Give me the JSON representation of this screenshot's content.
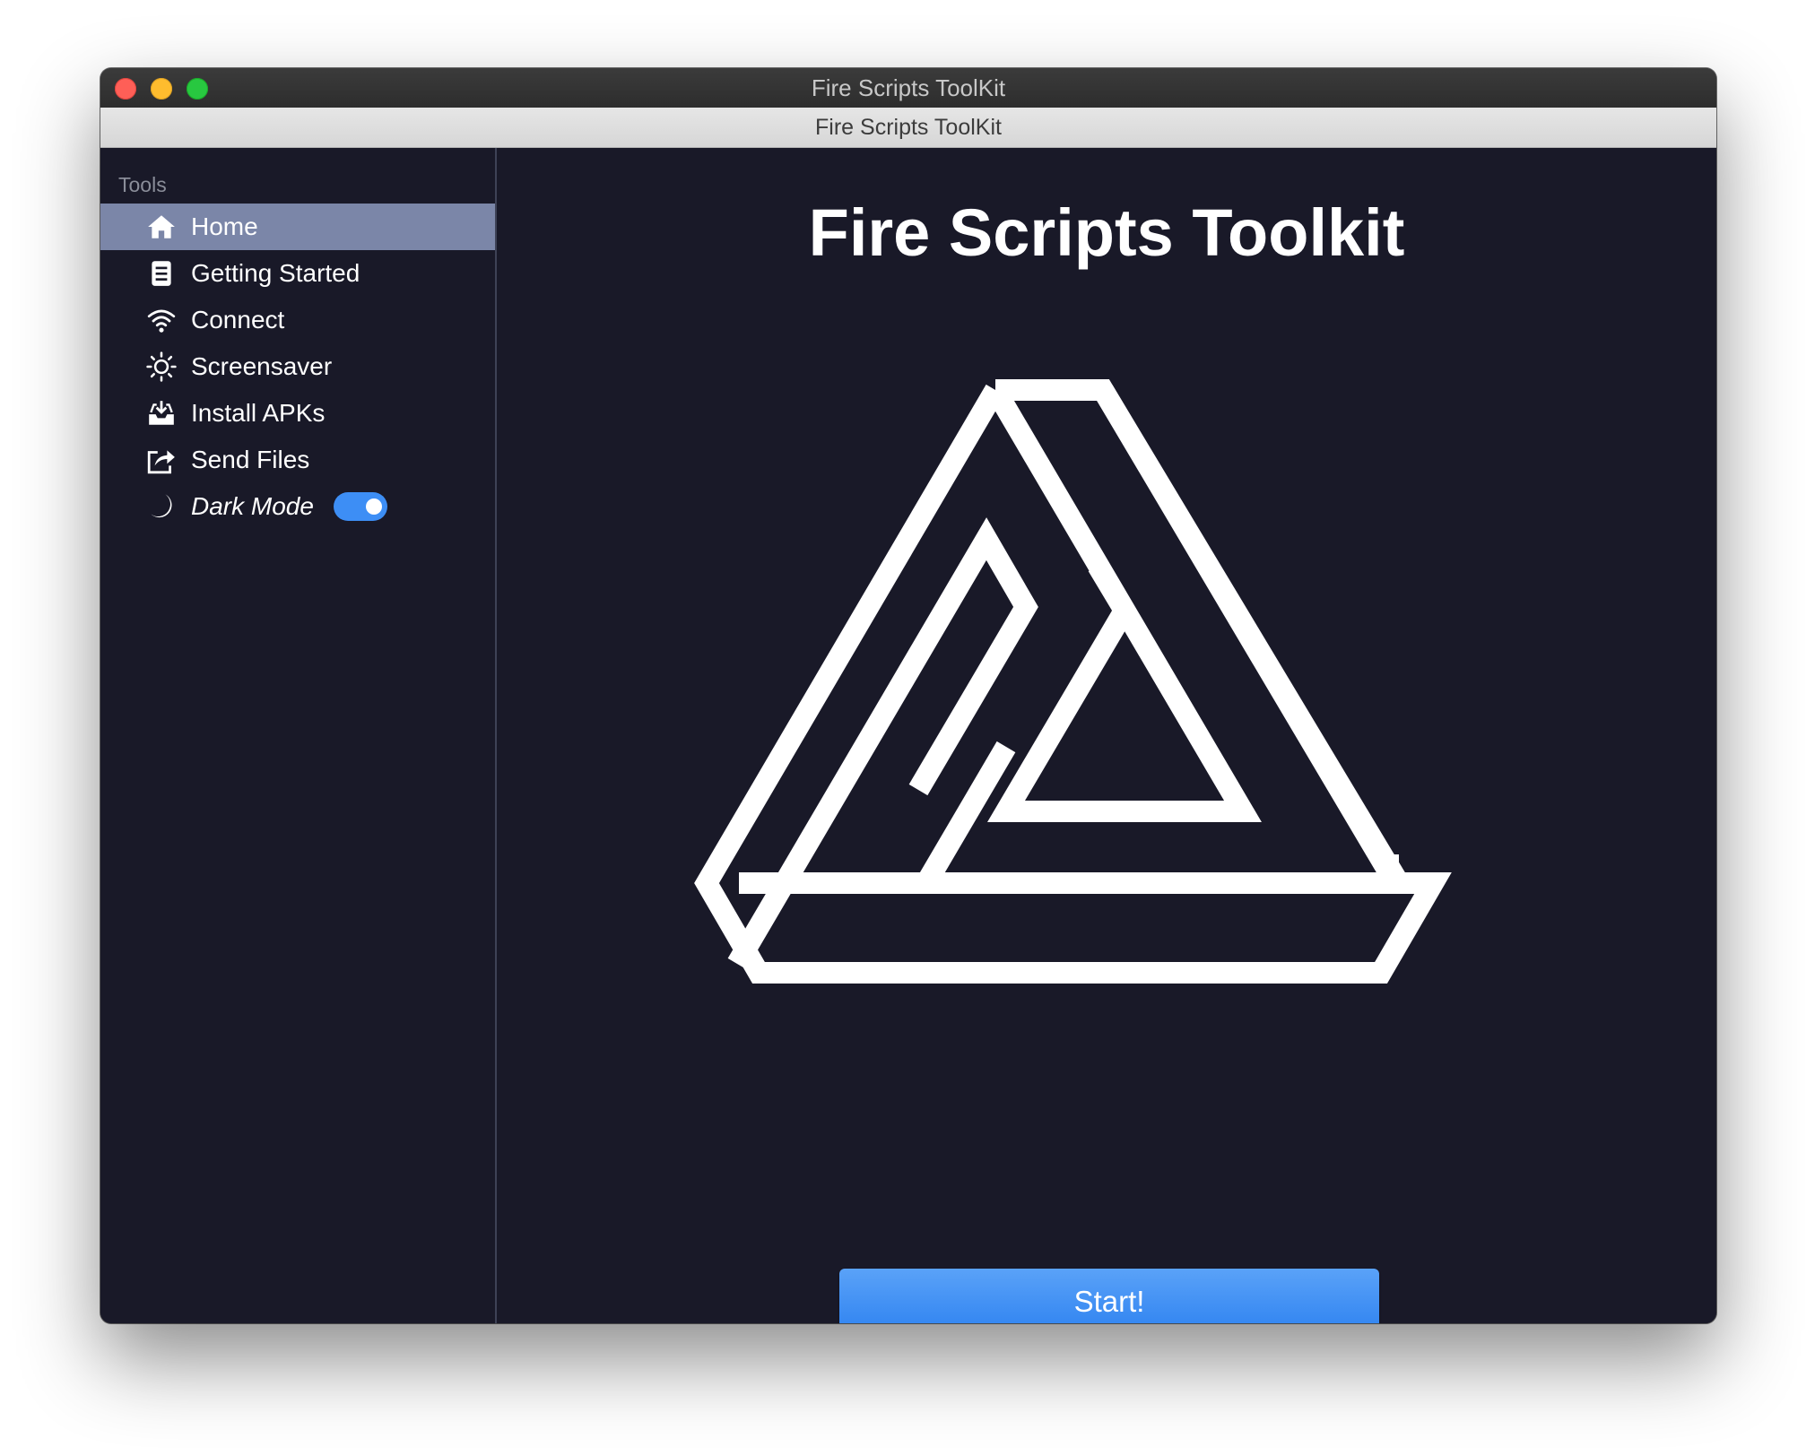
{
  "window": {
    "title": "Fire Scripts ToolKit"
  },
  "toolbar": {
    "title": "Fire Scripts ToolKit"
  },
  "sidebar": {
    "section_label": "Tools",
    "items": [
      {
        "label": "Home",
        "icon": "home-icon",
        "active": true
      },
      {
        "label": "Getting Started",
        "icon": "document-icon"
      },
      {
        "label": "Connect",
        "icon": "wifi-icon"
      },
      {
        "label": "Screensaver",
        "icon": "sun-icon"
      },
      {
        "label": "Install APKs",
        "icon": "inbox-download-icon"
      },
      {
        "label": "Send Files",
        "icon": "share-icon"
      }
    ],
    "dark_mode": {
      "label": "Dark Mode",
      "icon": "moon-icon",
      "enabled": true
    }
  },
  "main": {
    "title": "Fire Scripts Toolkit",
    "logo": "impossible-triangle-logo",
    "start_button": "Start!"
  },
  "colors": {
    "background": "#191928",
    "sidebar_active": "#7b86a8",
    "accent": "#3d8ef5",
    "toolbar": "#dcdcdc"
  }
}
